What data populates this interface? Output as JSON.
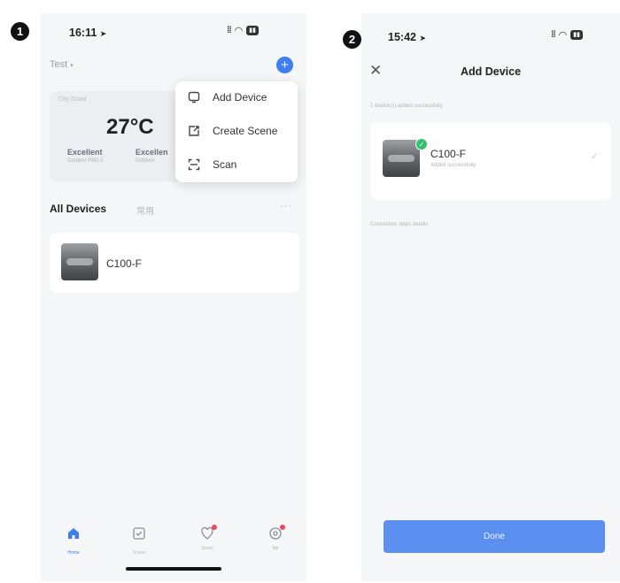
{
  "steps": {
    "step1": "1",
    "step2": "2"
  },
  "colors": {
    "accent": "#3d7ef0",
    "done_button": "#5b8ff0",
    "success": "#35c16b",
    "badge": "#ee4b5a"
  },
  "screen1": {
    "status_time": "16:11",
    "home_name": "Test",
    "add_button_icon": "plus-icon",
    "weather": {
      "caption": "City Good",
      "temperature": "27°C",
      "stats": [
        {
          "label": "Excellent",
          "sub": "Outdoor PM2.5"
        },
        {
          "label": "Excellen",
          "sub": "Outdoor"
        }
      ]
    },
    "menu": [
      {
        "label": "Add Device",
        "icon": "add-device-icon"
      },
      {
        "label": "Create Scene",
        "icon": "create-scene-icon"
      },
      {
        "label": "Scan",
        "icon": "scan-icon"
      }
    ],
    "section_title": "All Devices",
    "section_tab2": "常用",
    "more_label": "···",
    "device_name": "C100-F",
    "tabs": [
      {
        "label": "Home",
        "icon": "home-icon",
        "active": true
      },
      {
        "label": "Scene",
        "icon": "scene-icon",
        "active": false
      },
      {
        "label": "Smart",
        "icon": "smart-icon",
        "active": false
      },
      {
        "label": "Me",
        "icon": "profile-icon",
        "active": false
      }
    ]
  },
  "screen2": {
    "status_time": "15:42",
    "title": "Add Device",
    "header_caption": "1 device(s) added successfully",
    "device_name": "C100-F",
    "device_sub": "Added successfully",
    "section_caption": "Connection steps details",
    "done_label": "Done"
  }
}
